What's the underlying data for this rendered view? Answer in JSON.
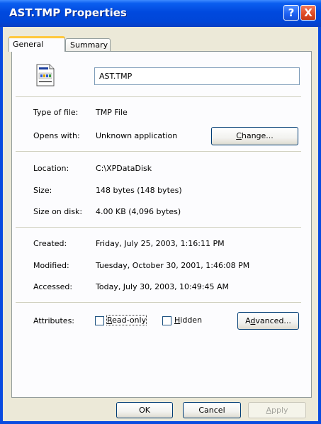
{
  "window": {
    "title": "AST.TMP Properties",
    "help_glyph": "?",
    "close_glyph": "X"
  },
  "tabs": [
    {
      "label": "General"
    },
    {
      "label": "Summary"
    }
  ],
  "file": {
    "name": "AST.TMP",
    "icon": "tmp-file-icon"
  },
  "info": {
    "type_label": "Type of file:",
    "type_value": "TMP File",
    "opens_label": "Opens with:",
    "opens_value": "Unknown application",
    "change_button": {
      "prefix": "",
      "mnemonic": "C",
      "rest": "hange..."
    },
    "location_label": "Location:",
    "location_value": "C:\\XPDataDisk",
    "size_label": "Size:",
    "size_value": "148 bytes (148 bytes)",
    "size_on_disk_label": "Size on disk:",
    "size_on_disk_value": "4.00 KB (4,096 bytes)",
    "created_label": "Created:",
    "created_value": "Friday, July 25, 2003, 1:16:11 PM",
    "modified_label": "Modified:",
    "modified_value": "Tuesday, October 30, 2001, 1:46:08 PM",
    "accessed_label": "Accessed:",
    "accessed_value": "Today, July 30, 2003, 10:49:45 AM"
  },
  "attributes": {
    "label": "Attributes:",
    "readonly": {
      "mnemonic": "R",
      "rest": "ead-only",
      "checked": false
    },
    "hidden": {
      "mnemonic": "H",
      "rest": "idden",
      "checked": false
    },
    "advanced_button": {
      "prefix": "A",
      "mnemonic": "d",
      "rest": "vanced..."
    }
  },
  "buttons": {
    "ok": "OK",
    "cancel": "Cancel",
    "apply": {
      "mnemonic": "A",
      "rest": "pply"
    }
  },
  "colors": {
    "title_bar": "#0049de",
    "dialog_bg": "#ece9d8",
    "tab_highlight": "#ffc83c",
    "close_red": "#e04a24"
  }
}
